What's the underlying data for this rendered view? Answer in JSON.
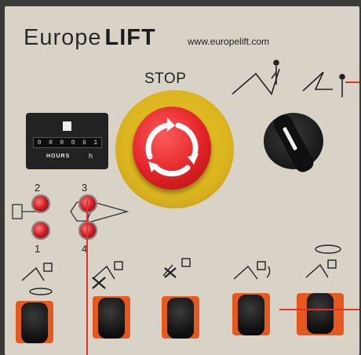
{
  "brand": {
    "name_light": "Europe",
    "name_bold": "LIFT",
    "url": "www.europelift.com"
  },
  "stop": {
    "label": "STOP"
  },
  "hour_meter": {
    "digits": [
      "0",
      "0",
      "0",
      "0",
      "6",
      "1"
    ],
    "hours_label": "HOURS",
    "symbol": "h"
  },
  "lamps": [
    {
      "number": "2"
    },
    {
      "number": "3"
    },
    {
      "number": "1"
    },
    {
      "number": "4"
    }
  ],
  "icons": {
    "estop": "emergency-stop-icon",
    "selector": "platform-selector-icon",
    "lamps": "indicator-lamp-icon",
    "toggles": "joystick-toggle-icon"
  },
  "colors": {
    "panel": "#d9d2c6",
    "stop_red": "#e22326",
    "stop_yellow": "#e9c52a",
    "plate_orange": "#e6591e"
  }
}
